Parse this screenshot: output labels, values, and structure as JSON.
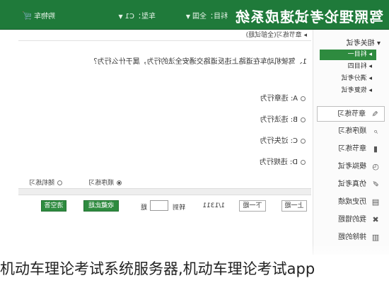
{
  "header": {
    "brand": "驾照理论考试速成系统",
    "subject_label": "科目：全国",
    "car_label": "车型：C1",
    "cart_label": "购物车",
    "cart_icon": "cart-icon"
  },
  "sidebar": {
    "group_title": "相关考试",
    "sub_items": [
      "科目一",
      "科目四",
      "满分考试",
      "恢复考试"
    ],
    "active_sub": 0,
    "items": [
      {
        "label": "章节练习",
        "icon": "pencil-icon",
        "glyph": "✎"
      },
      {
        "label": "顺序练习",
        "icon": "search-icon",
        "glyph": "⌕"
      },
      {
        "label": "章节练习",
        "icon": "bar-chart-icon",
        "glyph": "▮"
      },
      {
        "label": "模拟考试",
        "icon": "clock-icon",
        "glyph": "◷"
      },
      {
        "label": "仿真考试",
        "icon": "pencil-icon",
        "glyph": "✐"
      },
      {
        "label": "历史成绩",
        "icon": "history-icon",
        "glyph": "▤"
      },
      {
        "label": "我的错题",
        "icon": "cross-icon",
        "glyph": "✖"
      },
      {
        "label": "排除的题",
        "icon": "trash-icon",
        "glyph": "▥"
      }
    ],
    "selected_item": 0
  },
  "main": {
    "breadcrumb": "▸ 章节练习(全部试题)",
    "question": "1、驾驶机动车在道路上违反道路交通安全法的行为，属于什么行为？",
    "options": [
      "A: 违章行为",
      "B: 违法行为",
      "C: 过失行为",
      "D: 违规行为"
    ],
    "modes": [
      "顺序练习",
      "随机练习"
    ],
    "selected_mode": 0,
    "buttons": {
      "prev": "上一题",
      "next": "下一题",
      "collect": "收藏此题",
      "clear": "清空答案"
    },
    "pager": "1/1311",
    "jump_label": "转到",
    "jump_suffix": "题",
    "jump_value": ""
  },
  "caption": "机动车理论考试系统服务器,机动车理论考试app"
}
